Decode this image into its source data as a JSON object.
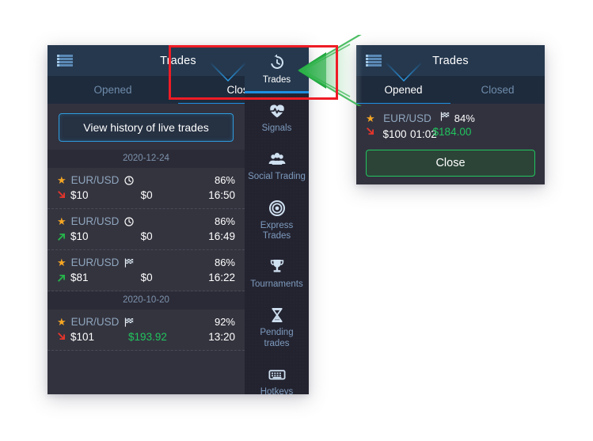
{
  "app": {
    "left_panel": {
      "header": {
        "title": "Trades",
        "menu_icon": "list-icon"
      },
      "tabs": [
        {
          "label": "Opened",
          "active": false
        },
        {
          "label": "Closed",
          "active": true
        }
      ],
      "pointer_icon": "chevron-down-icon",
      "history_button": "View history of live trades",
      "groups": [
        {
          "date": "2020-12-24",
          "trades": [
            {
              "star": "★",
              "symbol": "EUR/USD",
              "type_icon": "clock-icon",
              "percent": "86%",
              "direction": "down",
              "amount": "$10",
              "payout": "$0",
              "payout_profit": false,
              "time": "16:50"
            },
            {
              "star": "★",
              "symbol": "EUR/USD",
              "type_icon": "clock-icon",
              "percent": "86%",
              "direction": "up",
              "amount": "$10",
              "payout": "$0",
              "payout_profit": false,
              "time": "16:49"
            },
            {
              "star": "★",
              "symbol": "EUR/USD",
              "type_icon": "flag-icon",
              "percent": "86%",
              "direction": "up",
              "amount": "$81",
              "payout": "$0",
              "payout_profit": false,
              "time": "16:22"
            }
          ]
        },
        {
          "date": "2020-10-20",
          "trades": [
            {
              "star": "★",
              "symbol": "EUR/USD",
              "type_icon": "flag-icon",
              "percent": "92%",
              "direction": "down",
              "amount": "$101",
              "payout": "$193.92",
              "payout_profit": true,
              "time": "13:20"
            }
          ]
        }
      ]
    },
    "vnav": [
      {
        "label": "Trades",
        "icon": "history-clock-icon",
        "active": true
      },
      {
        "label": "Signals",
        "icon": "heart-pulse-icon",
        "active": false
      },
      {
        "label": "Social Trading",
        "icon": "people-icon",
        "active": false
      },
      {
        "label": "Express Trades",
        "icon": "target-icon",
        "active": false
      },
      {
        "label": "Tournaments",
        "icon": "trophy-icon",
        "active": false
      },
      {
        "label": "Pending trades",
        "icon": "hourglass-icon",
        "active": false
      },
      {
        "label": "Hotkeys",
        "icon": "keyboard-icon",
        "active": false
      }
    ],
    "right_panel": {
      "header": {
        "title": "Trades",
        "menu_icon": "list-icon"
      },
      "tabs": [
        {
          "label": "Opened",
          "active": true
        },
        {
          "label": "Closed",
          "active": false
        }
      ],
      "pointer_icon": "chevron-down-icon",
      "trade": {
        "star": "★",
        "symbol": "EUR/USD",
        "type_icon": "flag-icon",
        "percent": "84%",
        "direction": "down",
        "amount": "$100",
        "payout": "$184.00",
        "payout_profit": true,
        "time": "01:02"
      },
      "close_button": "Close"
    },
    "annotations": {
      "highlight_box": {
        "color": "#ee1c25",
        "shape": "rectangle"
      },
      "pointer_arrow": {
        "color": "#2fb34a",
        "shape": "left-chevron"
      }
    },
    "colors": {
      "accent_blue": "#1e8fe0",
      "header_navy": "#25384e",
      "panel_bg": "#32323f",
      "nav_bg": "#232330",
      "profit_green": "#21c45d",
      "star_orange": "#f5a623",
      "sell_red": "#e4352b",
      "buy_green": "#26b34a"
    }
  }
}
